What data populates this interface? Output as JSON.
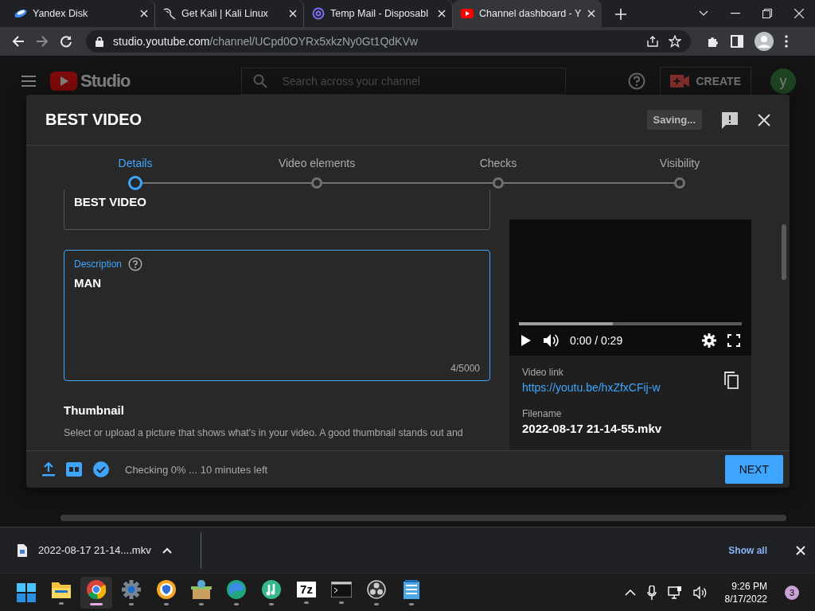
{
  "browser": {
    "tabs": [
      {
        "kind": "disk",
        "title": "Yandex Disk",
        "selected": false
      },
      {
        "kind": "kali",
        "title": "Get Kali | Kali Linux",
        "selected": false
      },
      {
        "kind": "mail",
        "title": "Temp Mail - Disposabl",
        "selected": false
      },
      {
        "kind": "youtube",
        "title": "Channel dashboard - Y",
        "selected": true
      }
    ],
    "address": {
      "host": "studio.youtube.com",
      "path": "/channel/UCpd0OYRx5xkzNy0Gt1QdKVw"
    }
  },
  "studio_header": {
    "logo": "Studio",
    "search": {
      "placeholder": "Search across your channel"
    },
    "create": "CREATE",
    "avatar": "y"
  },
  "dialog": {
    "title": "BEST VIDEO",
    "saving": "Saving...",
    "steps": [
      {
        "label": "Details",
        "selected": true
      },
      {
        "label": "Video elements",
        "selected": false
      },
      {
        "label": "Checks",
        "selected": false
      },
      {
        "label": "Visibility",
        "selected": false
      }
    ],
    "title_field": {
      "value": "BEST VIDEO"
    },
    "description": {
      "label": "Description",
      "value": "MAN",
      "counter": "4/5000"
    },
    "thumbnail": {
      "heading": "Thumbnail",
      "text": "Select or upload a picture that shows what's in your video. A good thumbnail stands out and"
    },
    "player": {
      "level": 0.42,
      "time": "0:00 / 0:29"
    },
    "video_link": {
      "label": "Video link",
      "url": "https://youtu.be/hxZfxCFij-w"
    },
    "filename": {
      "label": "Filename",
      "value": "2022-08-17 21-14-55.mkv"
    },
    "status": "Checking 0% ... 10 minutes left",
    "next": "NEXT"
  },
  "download_bar": {
    "file": "2022-08-17 21-14....mkv",
    "show_all": "Show all"
  },
  "taskbar": {
    "apps": [
      {
        "kind": "start",
        "selected": false
      },
      {
        "kind": "folder",
        "selected": false
      },
      {
        "kind": "chrome",
        "selected": true
      },
      {
        "kind": "settings",
        "selected": false
      },
      {
        "kind": "vpn",
        "selected": false
      },
      {
        "kind": "package",
        "selected": false
      },
      {
        "kind": "edge",
        "selected": false
      },
      {
        "kind": "music",
        "selected": false
      },
      {
        "kind": "archiver",
        "label": "7z",
        "selected": false
      },
      {
        "kind": "terminal",
        "selected": false
      },
      {
        "kind": "obs",
        "selected": false
      },
      {
        "kind": "notepad",
        "selected": false
      }
    ],
    "time": "9:26 PM",
    "date": "8/17/2022",
    "notifications": "3"
  }
}
